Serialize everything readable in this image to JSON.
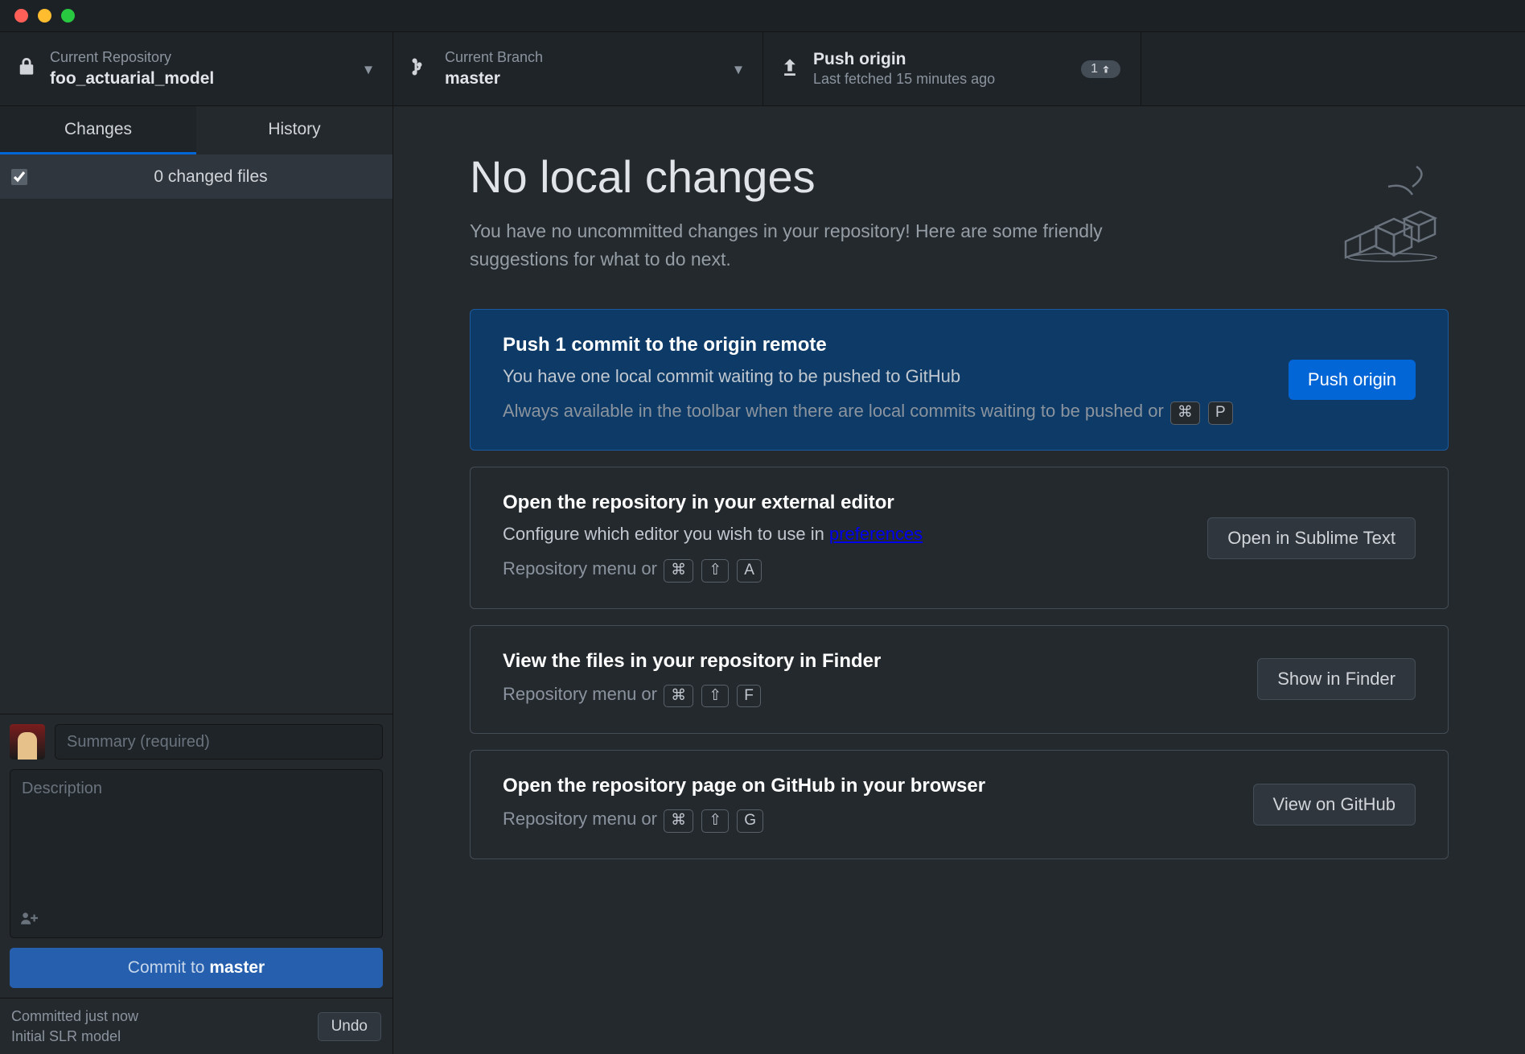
{
  "toolbar": {
    "repo": {
      "label": "Current Repository",
      "value": "foo_actuarial_model"
    },
    "branch": {
      "label": "Current Branch",
      "value": "master"
    },
    "push": {
      "label": "Push origin",
      "sub": "Last fetched 15 minutes ago",
      "badge_count": "1"
    }
  },
  "tabs": {
    "changes": "Changes",
    "history": "History"
  },
  "files_header": "0 changed files",
  "commit": {
    "summary_placeholder": "Summary (required)",
    "description_placeholder": "Description",
    "button_prefix": "Commit to ",
    "button_branch": "master"
  },
  "status": {
    "line1": "Committed just now",
    "line2": "Initial SLR model",
    "undo": "Undo"
  },
  "main": {
    "title": "No local changes",
    "subtitle": "You have no uncommitted changes in your repository! Here are some friendly suggestions for what to do next."
  },
  "cards": {
    "push": {
      "title": "Push 1 commit to the origin remote",
      "desc": "You have one local commit waiting to be pushed to GitHub",
      "hint_prefix": "Always available in the toolbar when there are local commits waiting to be pushed or ",
      "k1": "⌘",
      "k2": "P",
      "button": "Push origin"
    },
    "editor": {
      "title": "Open the repository in your external editor",
      "desc_prefix": "Configure which editor you wish to use in ",
      "desc_link": "preferences",
      "hint_prefix": "Repository menu or ",
      "k1": "⌘",
      "k2": "⇧",
      "k3": "A",
      "button": "Open in Sublime Text"
    },
    "finder": {
      "title": "View the files in your repository in Finder",
      "hint_prefix": "Repository menu or ",
      "k1": "⌘",
      "k2": "⇧",
      "k3": "F",
      "button": "Show in Finder"
    },
    "github": {
      "title": "Open the repository page on GitHub in your browser",
      "hint_prefix": "Repository menu or ",
      "k1": "⌘",
      "k2": "⇧",
      "k3": "G",
      "button": "View on GitHub"
    }
  }
}
